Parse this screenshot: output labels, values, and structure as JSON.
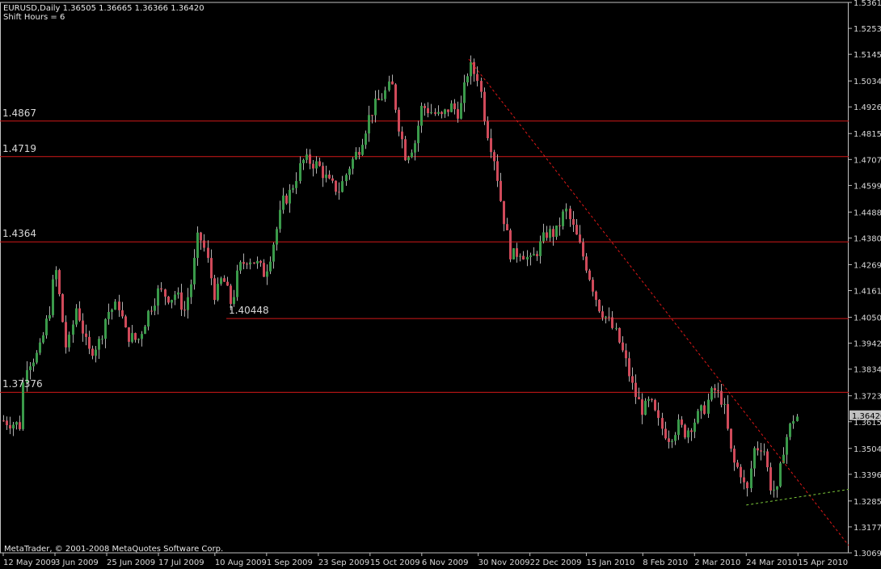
{
  "header": {
    "symbol_line": "EURUSD,Daily  1.36505 1.36665 1.36366 1.36420",
    "shift_line": "Shift Hours = 6"
  },
  "footer": {
    "copyright": "MetaTrader, © 2001-2008 MetaQuotes Software Corp."
  },
  "colors": {
    "background": "#000000",
    "axis": "#c0c0c0",
    "bull_candle": "#3a9a4a",
    "bear_candle": "#d04a5a",
    "wick": "#b0b0b0",
    "level_line": "#d01818",
    "trend_line_down": "#e01818",
    "trend_line_up": "#7cc83a",
    "price_tag": "#c0c0c0"
  },
  "chart_data": {
    "type": "candlestick",
    "symbol": "EURUSD",
    "timeframe": "Daily",
    "last_price": 1.3642,
    "ylim": [
      1.3069,
      1.5361
    ],
    "y_ticks": [
      "1.53610",
      "1.52530",
      "1.51450",
      "1.50340",
      "1.49260",
      "1.48150",
      "1.47070",
      "1.45990",
      "1.44880",
      "1.43800",
      "1.42690",
      "1.41610",
      "1.40500",
      "1.39420",
      "1.38340",
      "1.37230",
      "1.36150",
      "1.35040",
      "1.33960",
      "1.32850",
      "1.31770",
      "1.30690"
    ],
    "x_ticks": [
      "12 May 2009",
      "3 Jun 2009",
      "25 Jun 2009",
      "17 Jul 2009",
      "10 Aug 2009",
      "1 Sep 2009",
      "23 Sep 2009",
      "15 Oct 2009",
      "6 Nov 2009",
      "30 Nov 2009",
      "22 Dec 2009",
      "15 Jan 2010",
      "8 Feb 2010",
      "2 Mar 2010",
      "24 Mar 2010",
      "15 Apr 2010"
    ],
    "horizontal_levels": [
      {
        "label": "1.4867",
        "value": 1.4867
      },
      {
        "label": "1.4719",
        "value": 1.4719
      },
      {
        "label": "1.4364",
        "value": 1.4364
      },
      {
        "label": "1.40448",
        "value": 1.40448
      },
      {
        "label": "1.37376",
        "value": 1.37376
      }
    ],
    "price_path": [
      [
        "12 May 2009",
        1.362
      ],
      [
        "19 May 2009",
        1.36
      ],
      [
        "21 May 2009",
        1.385
      ],
      [
        "27 May 2009",
        1.39
      ],
      [
        "1 Jun 2009",
        1.41
      ],
      [
        "3 Jun 2009",
        1.427
      ],
      [
        "8 Jun 2009",
        1.39
      ],
      [
        "12 Jun 2009",
        1.41
      ],
      [
        "17 Jun 2009",
        1.39
      ],
      [
        "22 Jun 2009",
        1.395
      ],
      [
        "25 Jun 2009",
        1.407
      ],
      [
        "30 Jun 2009",
        1.41
      ],
      [
        "3 Jul 2009",
        1.398
      ],
      [
        "8 Jul 2009",
        1.395
      ],
      [
        "13 Jul 2009",
        1.408
      ],
      [
        "17 Jul 2009",
        1.416
      ],
      [
        "22 Jul 2009",
        1.413
      ],
      [
        "24 Jul 2009",
        1.415
      ],
      [
        "28 Jul 2009",
        1.408
      ],
      [
        "31 Jul 2009",
        1.42
      ],
      [
        "3 Aug 2009",
        1.44
      ],
      [
        "6 Aug 2009",
        1.432
      ],
      [
        "10 Aug 2009",
        1.413
      ],
      [
        "13 Aug 2009",
        1.422
      ],
      [
        "17 Aug 2009",
        1.41
      ],
      [
        "20 Aug 2009",
        1.425
      ],
      [
        "24 Aug 2009",
        1.43
      ],
      [
        "27 Aug 2009",
        1.428
      ],
      [
        "31 Aug 2009",
        1.423
      ],
      [
        "3 Sep 2009",
        1.433
      ],
      [
        "8 Sep 2009",
        1.453
      ],
      [
        "11 Sep 2009",
        1.457
      ],
      [
        "16 Sep 2009",
        1.47
      ],
      [
        "19 Sep 2009",
        1.47
      ],
      [
        "23 Sep 2009",
        1.468
      ],
      [
        "28 Sep 2009",
        1.46
      ],
      [
        "2 Oct 2009",
        1.458
      ],
      [
        "6 Oct 2009",
        1.468
      ],
      [
        "10 Oct 2009",
        1.475
      ],
      [
        "15 Oct 2009",
        1.49
      ],
      [
        "20 Oct 2009",
        1.497
      ],
      [
        "24 Oct 2009",
        1.502
      ],
      [
        "27 Oct 2009",
        1.485
      ],
      [
        "30 Oct 2009",
        1.472
      ],
      [
        "3 Nov 2009",
        1.478
      ],
      [
        "6 Nov 2009",
        1.493
      ],
      [
        "11 Nov 2009",
        1.49
      ],
      [
        "14 Nov 2009",
        1.488
      ],
      [
        "18 Nov 2009",
        1.493
      ],
      [
        "22 Nov 2009",
        1.49
      ],
      [
        "26 Nov 2009",
        1.51
      ],
      [
        "28 Nov 2009",
        1.507
      ],
      [
        "30 Nov 2009",
        1.505
      ],
      [
        "3 Dec 2009",
        1.485
      ],
      [
        "7 Dec 2009",
        1.47
      ],
      [
        "10 Dec 2009",
        1.45
      ],
      [
        "14 Dec 2009",
        1.43
      ],
      [
        "18 Dec 2009",
        1.433
      ],
      [
        "22 Dec 2009",
        1.428
      ],
      [
        "25 Dec 2009",
        1.433
      ],
      [
        "29 Dec 2009",
        1.44
      ],
      [
        "2 Jan 2010",
        1.44
      ],
      [
        "6 Jan 2010",
        1.45
      ],
      [
        "10 Jan 2010",
        1.44
      ],
      [
        "15 Jan 2010",
        1.426
      ],
      [
        "20 Jan 2010",
        1.41
      ],
      [
        "24 Jan 2010",
        1.404
      ],
      [
        "28 Jan 2010",
        1.397
      ],
      [
        "1 Feb 2010",
        1.385
      ],
      [
        "4 Feb 2010",
        1.374
      ],
      [
        "8 Feb 2010",
        1.366
      ],
      [
        "11 Feb 2010",
        1.37
      ],
      [
        "15 Feb 2010",
        1.36
      ],
      [
        "19 Feb 2010",
        1.355
      ],
      [
        "23 Feb 2010",
        1.36
      ],
      [
        "26 Feb 2010",
        1.357
      ],
      [
        "2 Mar 2010",
        1.362
      ],
      [
        "6 Mar 2010",
        1.367
      ],
      [
        "10 Mar 2010",
        1.375
      ],
      [
        "14 Mar 2010",
        1.37
      ],
      [
        "18 Mar 2010",
        1.345
      ],
      [
        "22 Mar 2010",
        1.34
      ],
      [
        "24 Mar 2010",
        1.33
      ],
      [
        "27 Mar 2010",
        1.35
      ],
      [
        "31 Mar 2010",
        1.352
      ],
      [
        "3 Apr 2010",
        1.335
      ],
      [
        "6 Apr 2010",
        1.332
      ],
      [
        "9 Apr 2010",
        1.352
      ],
      [
        "13 Apr 2010",
        1.363
      ],
      [
        "15 Apr 2010",
        1.364
      ]
    ]
  }
}
